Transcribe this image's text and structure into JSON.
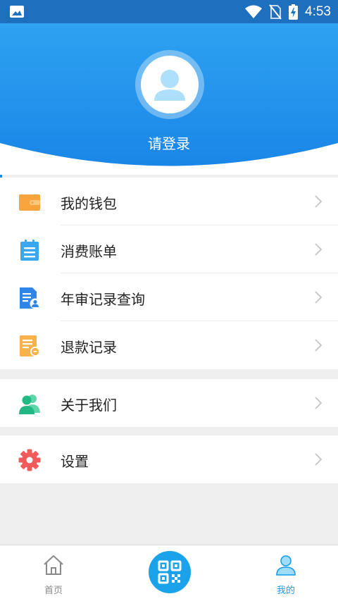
{
  "status_bar": {
    "time": "4:53",
    "icons": [
      "gallery-icon",
      "wifi-icon",
      "no-sim-icon",
      "battery-charging-icon"
    ]
  },
  "header": {
    "login_prompt": "请登录",
    "avatar_icon": "user-avatar-icon"
  },
  "menu": {
    "group1": [
      {
        "label": "我的钱包",
        "icon": "wallet-icon"
      },
      {
        "label": "消费账单",
        "icon": "bill-clipboard-icon"
      },
      {
        "label": "年审记录查询",
        "icon": "annual-review-document-icon"
      },
      {
        "label": "退款记录",
        "icon": "refund-record-icon"
      }
    ],
    "group2": [
      {
        "label": "关于我们",
        "icon": "users-icon"
      }
    ],
    "group3": [
      {
        "label": "设置",
        "icon": "gear-icon"
      }
    ]
  },
  "tabbar": {
    "tabs": [
      {
        "label": "首页",
        "icon": "home-icon",
        "active": false
      },
      {
        "label": "",
        "icon": "qr-code-icon",
        "active": false
      },
      {
        "label": "我的",
        "icon": "profile-icon",
        "active": true
      }
    ]
  },
  "colors": {
    "header_top": "#2a9ff0",
    "header_bottom": "#1a86e8",
    "status_bar": "#1f6fbf",
    "active_tab": "#1a9de8",
    "inactive_tab": "#8a8a8a",
    "wallet": "#f7a43c",
    "bill": "#3aa8f0",
    "annual": "#2f86e8",
    "refund": "#f7b24a",
    "about": "#2bbd8c",
    "settings": "#f05a5a"
  }
}
